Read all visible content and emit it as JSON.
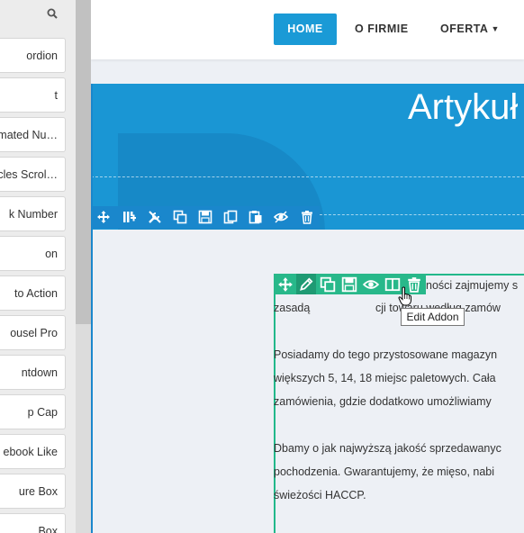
{
  "sidebar": {
    "search_icon": "search-icon",
    "items": [
      {
        "label": "ordion"
      },
      {
        "label": "t"
      },
      {
        "label": "mated Nu…"
      },
      {
        "label": "cles Scrol…"
      },
      {
        "label": "k Number"
      },
      {
        "label": "on"
      },
      {
        "label": "to Action"
      },
      {
        "label": "ousel Pro"
      },
      {
        "label": "ntdown"
      },
      {
        "label": "p Cap"
      },
      {
        "label": "ebook Like"
      },
      {
        "label": "ure Box"
      },
      {
        "label": "Box"
      }
    ]
  },
  "header": {
    "nav": [
      {
        "label": "HOME",
        "active": true
      },
      {
        "label": "O FIRMIE"
      },
      {
        "label": "OFERTA",
        "has_dropdown": true
      }
    ],
    "accent_color": "#1a9ad6"
  },
  "hero": {
    "title": "Artykuł"
  },
  "section_toolbar": {
    "icons": [
      "move-icon",
      "columns-icon",
      "settings-icon",
      "copy-icon",
      "save-icon",
      "duplicate-icon",
      "paste-icon",
      "visibility-icon",
      "trash-icon"
    ],
    "color": "#1a87cc"
  },
  "addon_toolbar": {
    "icons": [
      "move-icon",
      "edit-icon",
      "copy-icon",
      "save-icon",
      "visibility-icon",
      "columns-icon",
      "trash-icon"
    ],
    "color": "#28b88a",
    "tooltip": "Edit Addon"
  },
  "content": {
    "lines": [
      "ności zajmujemy s",
      "zasadą",
      "cji towaru według zamów",
      "Posiadamy do tego przystosowane magazyn",
      "większych 5, 14, 18 miejsc paletowych. Cała",
      "zamówienia, gdzie dodatkowo umożliwiamy",
      "Dbamy o jak najwyższą jakość sprzedawanyc",
      "pochodzenia. Gwarantujemy, że mięso, nabi",
      "świeżości HACCP."
    ]
  }
}
